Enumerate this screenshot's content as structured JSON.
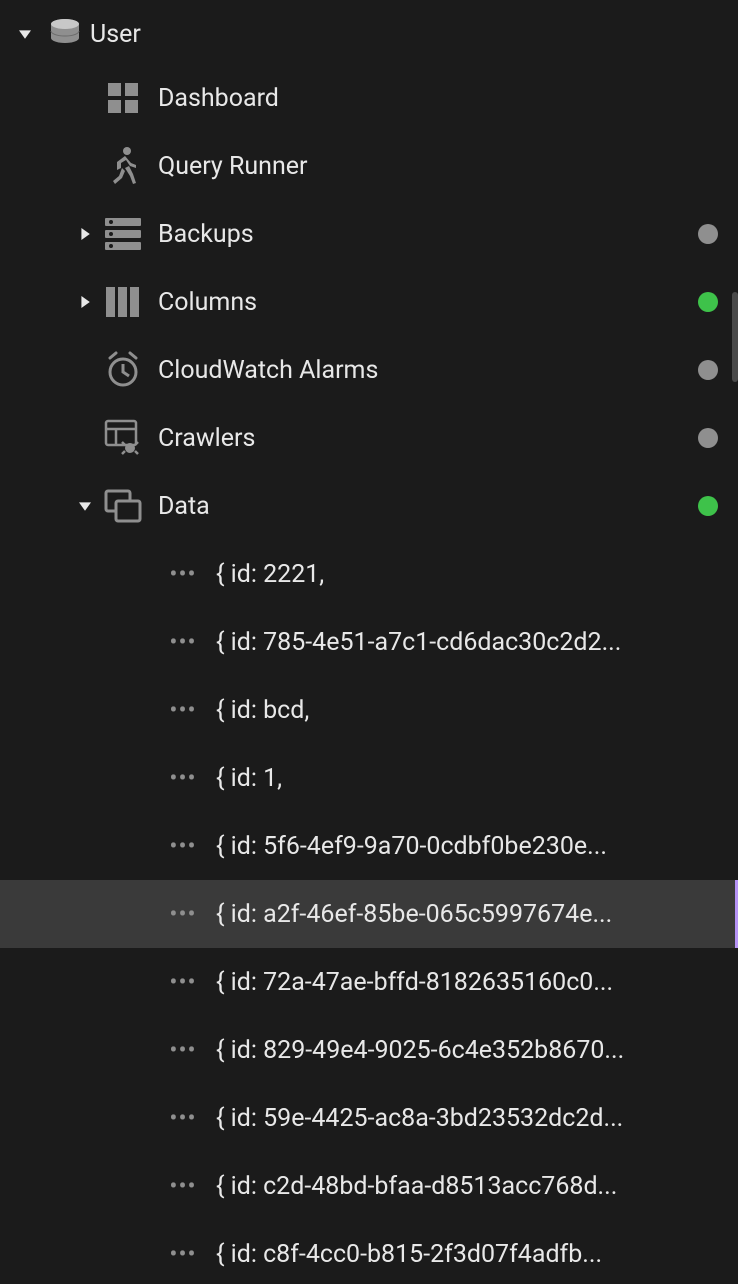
{
  "colors": {
    "status_gray": "#8f8f8f",
    "status_green": "#3ec24a",
    "highlight_bar": "#b794f6"
  },
  "tree": {
    "root": {
      "label": "User",
      "icon": "database-icon",
      "expanded": true
    },
    "children": [
      {
        "label": "Dashboard",
        "icon": "dashboard-icon",
        "expandable": false,
        "status": null
      },
      {
        "label": "Query Runner",
        "icon": "runner-icon",
        "expandable": false,
        "status": null
      },
      {
        "label": "Backups",
        "icon": "storage-icon",
        "expandable": true,
        "expanded": false,
        "status": "gray"
      },
      {
        "label": "Columns",
        "icon": "columns-icon",
        "expandable": true,
        "expanded": false,
        "status": "green"
      },
      {
        "label": "CloudWatch Alarms",
        "icon": "alarm-icon",
        "expandable": false,
        "status": "gray"
      },
      {
        "label": "Crawlers",
        "icon": "crawlers-icon",
        "expandable": false,
        "status": "gray"
      },
      {
        "label": "Data",
        "icon": "data-icon",
        "expandable": true,
        "expanded": true,
        "status": "green",
        "items": [
          {
            "text": "{ id: 2221,"
          },
          {
            "text": "{ id: 785-4e51-a7c1-cd6dac30c2d2..."
          },
          {
            "text": "{ id: bcd,"
          },
          {
            "text": "{ id: 1,"
          },
          {
            "text": "{ id: 5f6-4ef9-9a70-0cdbf0be230e..."
          },
          {
            "text": "{ id: a2f-46ef-85be-065c5997674e...",
            "selected": true
          },
          {
            "text": "{ id: 72a-47ae-bffd-8182635160c0..."
          },
          {
            "text": "{ id: 829-49e4-9025-6c4e352b8670..."
          },
          {
            "text": "{ id: 59e-4425-ac8a-3bd23532dc2d..."
          },
          {
            "text": "{ id: c2d-48bd-bfaa-d8513acc768d..."
          },
          {
            "text": "{ id: c8f-4cc0-b815-2f3d07f4adfb..."
          }
        ]
      }
    ]
  }
}
